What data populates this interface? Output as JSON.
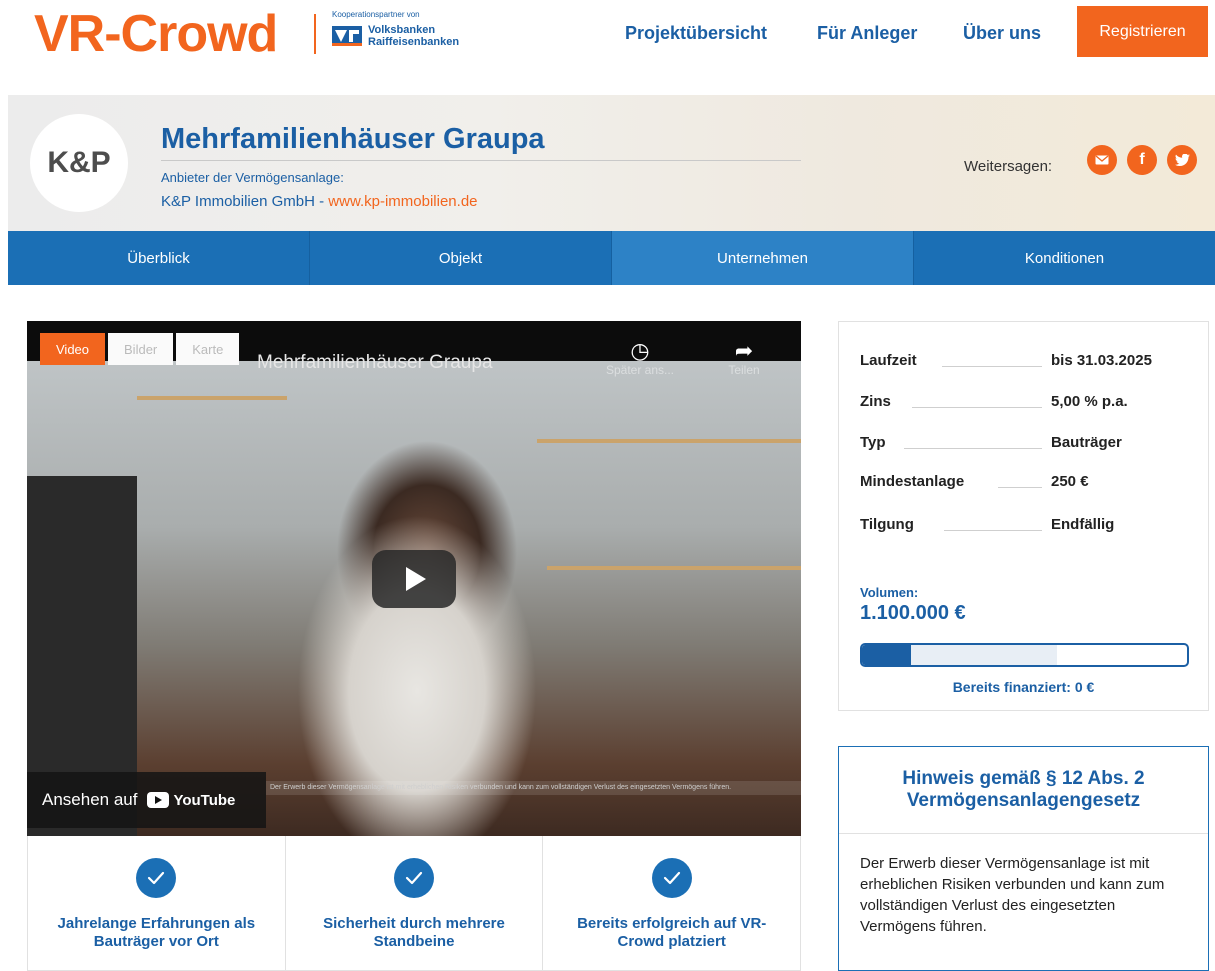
{
  "header": {
    "logo": "VR-Crowd",
    "partner_caption": "Kooperationspartner von",
    "partner_name_line1": "Volksbanken",
    "partner_name_line2": "Raiffeisenbanken",
    "nav": [
      "Projektübersicht",
      "Für Anleger",
      "Über uns"
    ],
    "register_label": "Registrieren"
  },
  "project": {
    "logo_text": "K&P",
    "title": "Mehrfamilienhäuser Graupa",
    "provider_label": "Anbieter der Vermögensanlage:",
    "provider_name": "K&P Immobilien GmbH - ",
    "provider_website": "www.kp-immobilien.de",
    "share_label": "Weitersagen:",
    "share_icons": [
      "mail-icon",
      "facebook-icon",
      "twitter-icon"
    ]
  },
  "tabs": [
    {
      "label": "Überblick"
    },
    {
      "label": "Objekt"
    },
    {
      "label": "Unternehmen"
    },
    {
      "label": "Konditionen"
    }
  ],
  "media": {
    "tabs": [
      "Video",
      "Bilder",
      "Karte"
    ],
    "video_title": "Mehrfamilienhäuser Graupa",
    "watch_later": "Später ans...",
    "share": "Teilen",
    "watch_on": "Ansehen auf",
    "youtube": "YouTube",
    "ticker": "Der Erwerb dieser Vermögensanlage ist mit erheblichen Risiken verbunden und kann zum vollständigen Verlust des eingesetzten Vermögens führen."
  },
  "features": [
    {
      "text": "Jahrelange Erfahrungen als Bauträger vor Ort"
    },
    {
      "text": "Sicherheit durch mehrere Standbeine"
    },
    {
      "text": "Bereits erfolgreich auf VR-Crowd platziert"
    }
  ],
  "conditions": {
    "rows": [
      {
        "key": "Laufzeit",
        "value": "bis 31.03.2025"
      },
      {
        "key": "Zins",
        "value": "5,00 % p.a."
      },
      {
        "key": "Typ",
        "value": "Bauträger"
      },
      {
        "key": "Mindestanlage",
        "value": "250 €"
      },
      {
        "key": "Tilgung",
        "value": "Endfällig"
      }
    ],
    "volume_label": "Volumen:",
    "volume_value": "1.100.000 €",
    "financed": "Bereits finanziert: 0 €"
  },
  "notice": {
    "title": "Hinweis gemäß § 12 Abs. 2 Vermögensanlagengesetz",
    "body": "Der Erwerb dieser Vermögensanlage ist mit erheblichen Risiken verbunden und kann zum vollständigen Verlust des eingesetzten Vermögens führen."
  },
  "colors": {
    "brand_orange": "#f2651e",
    "brand_blue": "#1b5fa4",
    "tab_blue": "#1b6fb5"
  }
}
